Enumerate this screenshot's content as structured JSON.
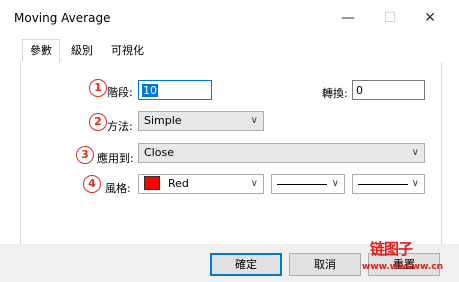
{
  "window": {
    "title": "Moving Average",
    "minimize_glyph": "—",
    "maximize_glyph": "☐",
    "close_glyph": "✕"
  },
  "tabs": [
    {
      "label": "參數",
      "active": true
    },
    {
      "label": "級別",
      "active": false
    },
    {
      "label": "可視化",
      "active": false
    }
  ],
  "params": {
    "period": {
      "marker": "1",
      "label": "階段:",
      "value": "10"
    },
    "shift": {
      "label": "轉換:",
      "value": "0"
    },
    "method": {
      "marker": "2",
      "label": "方法:",
      "value": "Simple"
    },
    "apply_to": {
      "marker": "3",
      "label": "應用到:",
      "value": "Close"
    },
    "style": {
      "marker": "4",
      "label": "風格:",
      "color_name": "Red",
      "color_hex": "#ff0000"
    }
  },
  "buttons": {
    "ok": "確定",
    "cancel": "取消",
    "reset": "重置"
  },
  "watermark": {
    "line1": "链图子",
    "line2": "www.wwsww.cn"
  },
  "colors": {
    "accent": "#0078d7",
    "marker": "#e0301e"
  }
}
